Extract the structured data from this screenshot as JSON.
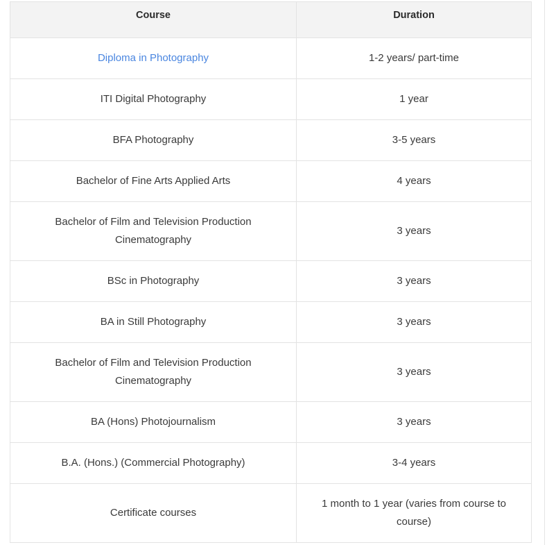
{
  "table": {
    "headers": {
      "course": "Course",
      "duration": "Duration"
    },
    "rows": [
      {
        "course": "Diploma in Photography",
        "duration": "1-2 years/ part-time",
        "link": true
      },
      {
        "course": "ITI Digital Photography",
        "duration": "1 year"
      },
      {
        "course": "BFA Photography",
        "duration": "3-5 years"
      },
      {
        "course": "Bachelor of Fine Arts Applied Arts",
        "duration": "4 years"
      },
      {
        "course": "Bachelor of Film and Television Production Cinematography",
        "duration": "3 years"
      },
      {
        "course": "BSc in Photography",
        "duration": "3 years"
      },
      {
        "course": "BA in Still Photography",
        "duration": "3 years"
      },
      {
        "course": "Bachelor of Film and Television Production Cinematography",
        "duration": "3 years"
      },
      {
        "course": "BA (Hons) Photojournalism",
        "duration": "3 years"
      },
      {
        "course": "B.A. (Hons.) (Commercial Photography)",
        "duration": "3-4 years"
      },
      {
        "course": "Certificate courses",
        "duration": "1 month to 1 year (varies from course to course)"
      }
    ]
  },
  "colors": {
    "link": "#4a86e0",
    "header_bg": "#f3f3f3",
    "border": "#e3e3e3"
  }
}
